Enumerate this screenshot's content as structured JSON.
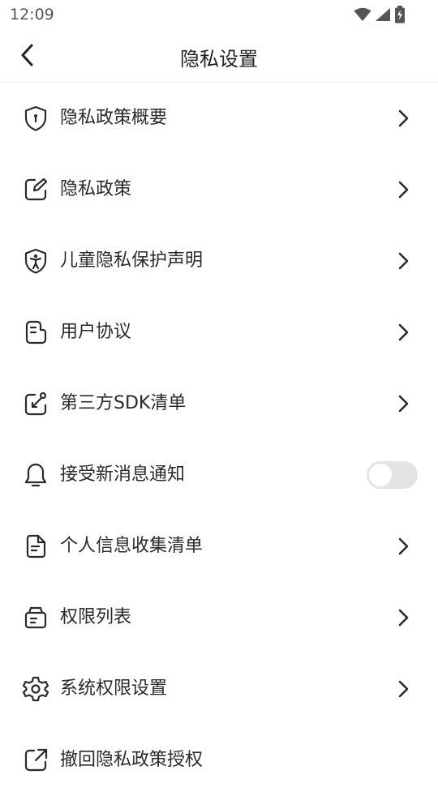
{
  "status_bar": {
    "time": "12:09"
  },
  "app_bar": {
    "title": "隐私设置"
  },
  "items": [
    {
      "label": "隐私政策概要",
      "icon": "shield-lock-icon",
      "type": "link"
    },
    {
      "label": "隐私政策",
      "icon": "edit-note-icon",
      "type": "link"
    },
    {
      "label": "儿童隐私保护声明",
      "icon": "child-shield-icon",
      "type": "link"
    },
    {
      "label": "用户协议",
      "icon": "document-icon",
      "type": "link"
    },
    {
      "label": "第三方SDK清单",
      "icon": "external-edit-icon",
      "type": "link"
    },
    {
      "label": "接受新消息通知",
      "icon": "bell-icon",
      "type": "toggle",
      "toggle_on": false
    },
    {
      "label": "个人信息收集清单",
      "icon": "file-list-icon",
      "type": "link"
    },
    {
      "label": "权限列表",
      "icon": "bag-list-icon",
      "type": "link"
    },
    {
      "label": "系统权限设置",
      "icon": "gear-icon",
      "type": "link"
    },
    {
      "label": "撤回隐私政策授权",
      "icon": "share-out-icon",
      "type": "link"
    }
  ]
}
